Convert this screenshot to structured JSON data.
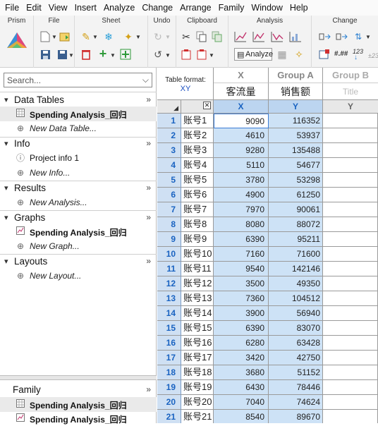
{
  "menu": [
    "File",
    "Edit",
    "View",
    "Insert",
    "Analyze",
    "Change",
    "Arrange",
    "Family",
    "Window",
    "Help"
  ],
  "ribbon": {
    "groups": [
      "Prism",
      "File",
      "Sheet",
      "Undo",
      "Clipboard",
      "Analysis",
      "Change"
    ],
    "analyze_label": "Analyze",
    "num_label": "123"
  },
  "nav": {
    "search_placeholder": "Search...",
    "sections": {
      "data_tables": "Data Tables",
      "info": "Info",
      "results": "Results",
      "graphs": "Graphs",
      "layouts": "Layouts",
      "family": "Family"
    },
    "items": {
      "data_table": "Spending  Analysis_回归",
      "new_data_table": "New Data Table...",
      "project_info": "Project info 1",
      "new_info": "New Info...",
      "new_analysis": "New Analysis...",
      "graph": "Spending  Analysis_回归",
      "new_graph": "New Graph...",
      "new_layout": "New Layout...",
      "family_table": "Spending  Analysis_回归",
      "family_graph": "Spending  Analysis_回归"
    }
  },
  "sheet": {
    "table_format_label": "Table format:",
    "table_format_value": "XY",
    "col_x_group": "X",
    "col_x_title": "客流量",
    "col_a_group": "Group A",
    "col_a_title": "销售额",
    "col_b_group": "Group B",
    "col_b_title": "Title",
    "sub_x": "X",
    "sub_y_a": "Y",
    "sub_y_b": "Y",
    "rows": [
      {
        "n": "1",
        "t": "账号1",
        "x": "9090",
        "y": "116352"
      },
      {
        "n": "2",
        "t": "账号2",
        "x": "4610",
        "y": "53937"
      },
      {
        "n": "3",
        "t": "账号3",
        "x": "9280",
        "y": "135488"
      },
      {
        "n": "4",
        "t": "账号4",
        "x": "5110",
        "y": "54677"
      },
      {
        "n": "5",
        "t": "账号5",
        "x": "3780",
        "y": "53298"
      },
      {
        "n": "6",
        "t": "账号6",
        "x": "4900",
        "y": "61250"
      },
      {
        "n": "7",
        "t": "账号7",
        "x": "7970",
        "y": "90061"
      },
      {
        "n": "8",
        "t": "账号8",
        "x": "8080",
        "y": "88072"
      },
      {
        "n": "9",
        "t": "账号9",
        "x": "6390",
        "y": "95211"
      },
      {
        "n": "10",
        "t": "账号10",
        "x": "7160",
        "y": "71600"
      },
      {
        "n": "11",
        "t": "账号11",
        "x": "9540",
        "y": "142146"
      },
      {
        "n": "12",
        "t": "账号12",
        "x": "3500",
        "y": "49350"
      },
      {
        "n": "13",
        "t": "账号13",
        "x": "7360",
        "y": "104512"
      },
      {
        "n": "14",
        "t": "账号14",
        "x": "3900",
        "y": "56940"
      },
      {
        "n": "15",
        "t": "账号15",
        "x": "6390",
        "y": "83070"
      },
      {
        "n": "16",
        "t": "账号16",
        "x": "6280",
        "y": "63428"
      },
      {
        "n": "17",
        "t": "账号17",
        "x": "3420",
        "y": "42750"
      },
      {
        "n": "18",
        "t": "账号18",
        "x": "3680",
        "y": "51152"
      },
      {
        "n": "19",
        "t": "账号19",
        "x": "6430",
        "y": "78446"
      },
      {
        "n": "20",
        "t": "账号20",
        "x": "7040",
        "y": "74624"
      },
      {
        "n": "21",
        "t": "账号21",
        "x": "8540",
        "y": "89670"
      }
    ]
  },
  "colors": {
    "accent_blue": "#1a63c1",
    "selected_col": "#cde2f6",
    "rownum_bg": "#cfe0f3",
    "header_group_gray": "#9a9a9a"
  }
}
